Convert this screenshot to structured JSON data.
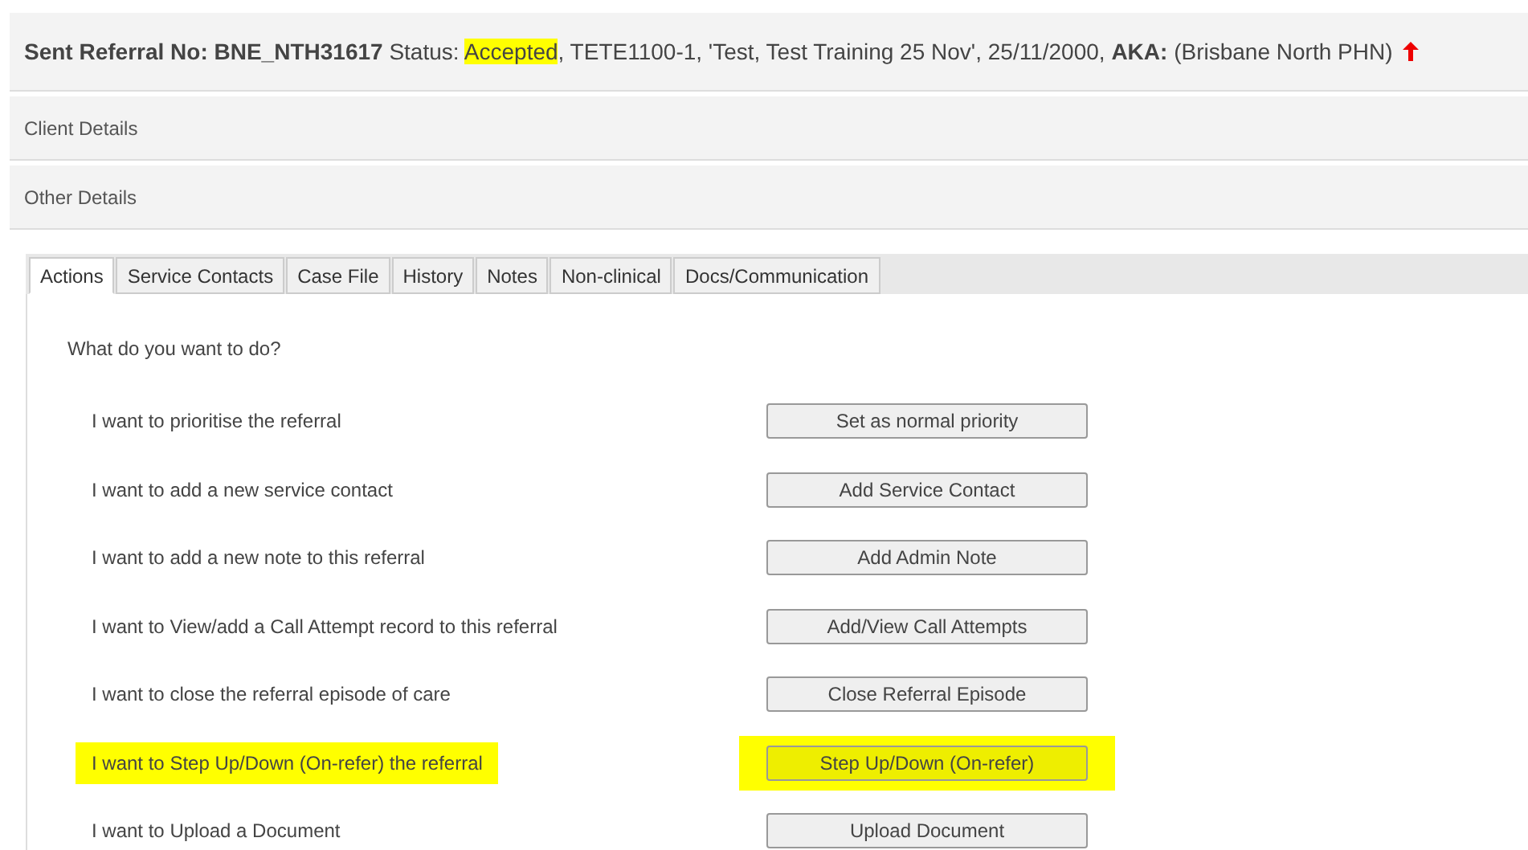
{
  "header": {
    "referral": "Sent Referral No: BNE_NTH31617",
    "status_label": "Status:",
    "status": {
      "text": "Accepted",
      "highlighted": true
    },
    "rest": ", TETE1100-1, 'Test, Test Training 25 Nov', 25/11/2000, **AKA:** (Brisbane North PHN)"
  },
  "sections": [
    {
      "title": "Client Details"
    },
    {
      "title": "Other Details"
    }
  ],
  "tabs": [
    {
      "label": "Actions",
      "selected": true
    },
    {
      "label": "Service Contacts",
      "selected": false
    },
    {
      "label": "Case File",
      "selected": false
    },
    {
      "label": "History",
      "selected": false
    },
    {
      "label": "Notes",
      "selected": false
    },
    {
      "label": "Non-clinical",
      "selected": false
    },
    {
      "label": "Docs/Communication",
      "selected": false
    }
  ],
  "prompt": "What do you want to do?",
  "actions": [
    {
      "text": "I want to prioritise the referral",
      "button": "Set as normal priority",
      "highlighted": false
    },
    {
      "text": "I want to add a new service contact",
      "button": "Add Service Contact",
      "highlighted": false
    },
    {
      "text": "I want to add a new note to this referral",
      "button": "Add Admin Note",
      "highlighted": false
    },
    {
      "text": "I want to View/add a Call Attempt record to this referral",
      "button": "Add/View Call Attempts",
      "highlighted": false
    },
    {
      "text": "I want to close the referral episode of care",
      "button": "Close Referral Episode",
      "highlighted": false
    },
    {
      "text": "I want to Step Up/Down (On-refer) the referral",
      "button": "Step Up/Down (On-refer)",
      "highlighted": true
    },
    {
      "text": "I want to Upload a Document",
      "button": "Upload Document",
      "highlighted": false
    }
  ]
}
